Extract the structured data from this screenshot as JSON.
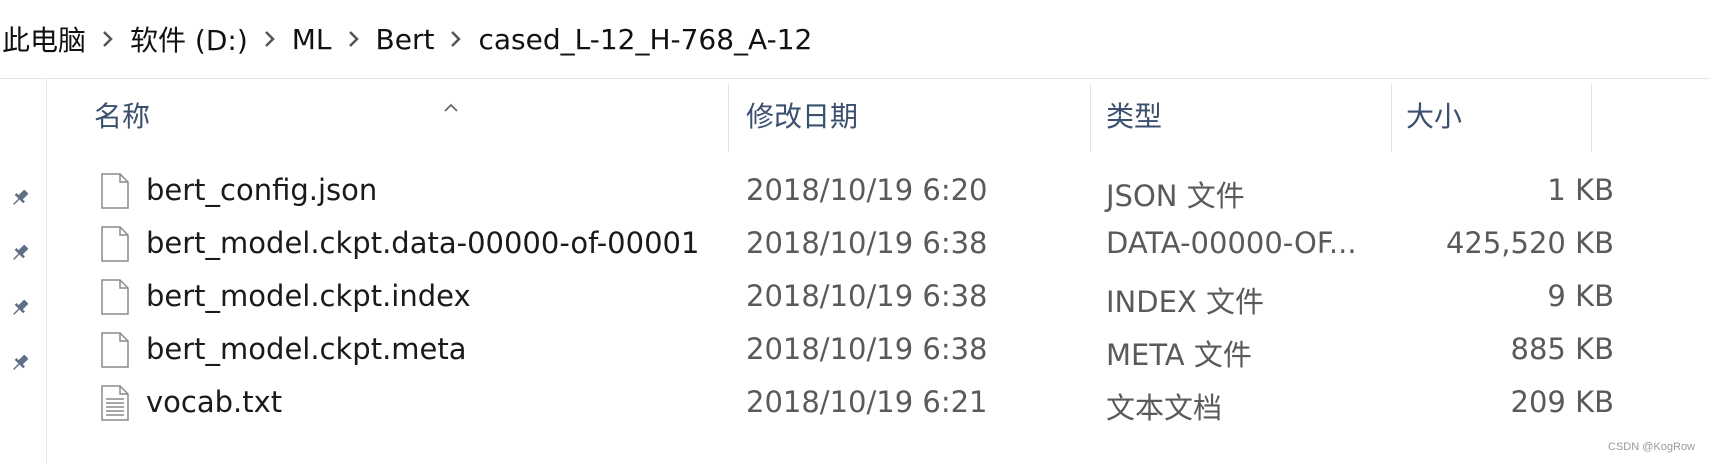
{
  "breadcrumb": {
    "items": [
      "此电脑",
      "软件 (D:)",
      "ML",
      "Bert",
      "cased_L-12_H-768_A-12"
    ]
  },
  "columns": {
    "name": "名称",
    "date": "修改日期",
    "type": "类型",
    "size": "大小"
  },
  "files": [
    {
      "name": "bert_config.json",
      "date": "2018/10/19 6:20",
      "type": "JSON 文件",
      "size": "1 KB",
      "icon": "file-icon"
    },
    {
      "name": "bert_model.ckpt.data-00000-of-00001",
      "date": "2018/10/19 6:38",
      "type": "DATA-00000-OF...",
      "size": "425,520 KB",
      "icon": "file-icon"
    },
    {
      "name": "bert_model.ckpt.index",
      "date": "2018/10/19 6:38",
      "type": "INDEX 文件",
      "size": "9 KB",
      "icon": "file-icon"
    },
    {
      "name": "bert_model.ckpt.meta",
      "date": "2018/10/19 6:38",
      "type": "META 文件",
      "size": "885 KB",
      "icon": "file-icon"
    },
    {
      "name": "vocab.txt",
      "date": "2018/10/19 6:21",
      "type": "文本文档",
      "size": "209 KB",
      "icon": "text-file-icon"
    }
  ],
  "sidebar": {
    "pins": [
      "pin-icon",
      "pin-icon",
      "pin-icon",
      "pin-icon"
    ]
  },
  "watermark": "CSDN @KogRow"
}
